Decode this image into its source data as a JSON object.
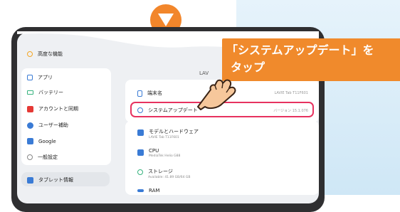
{
  "callout": {
    "line1": "「システムアップデート」を",
    "line2": "タップ"
  },
  "sidebar": {
    "items": [
      {
        "label": "高度な機能",
        "icon": "advanced-icon",
        "color": "#f4a623"
      },
      {
        "label": "アプリ",
        "icon": "apps-icon",
        "color": "#3a7bd5"
      },
      {
        "label": "バッテリー",
        "icon": "battery-icon",
        "color": "#36b37e"
      },
      {
        "label": "アカウントと同期",
        "icon": "account-icon",
        "color": "#e53935"
      },
      {
        "label": "ユーザー補助",
        "icon": "accessibility-icon",
        "color": "#3a7bd5"
      },
      {
        "label": "Google",
        "icon": "google-icon",
        "color": "#3a7bd5"
      },
      {
        "label": "一般設定",
        "icon": "general-settings-icon",
        "color": "#888888"
      },
      {
        "label": "タブレット情報",
        "icon": "tablet-info-icon",
        "color": "#3a7bd5"
      }
    ]
  },
  "header": {
    "label": "LAV"
  },
  "device_name": {
    "label": "端末名",
    "value": "LAVIE Tab T11F601"
  },
  "system_update": {
    "label": "システムアップデート",
    "value": "バージョン 15.1.076"
  },
  "specs": [
    {
      "label": "モデルとハードウェア",
      "sub": "LAVIE Tab T11F601"
    },
    {
      "label": "CPU",
      "sub": "MediaTek Helio G88"
    },
    {
      "label": "ストレージ",
      "sub": "Available: 41.89 GB/64 GB"
    },
    {
      "label": "RAM",
      "sub": ""
    }
  ]
}
